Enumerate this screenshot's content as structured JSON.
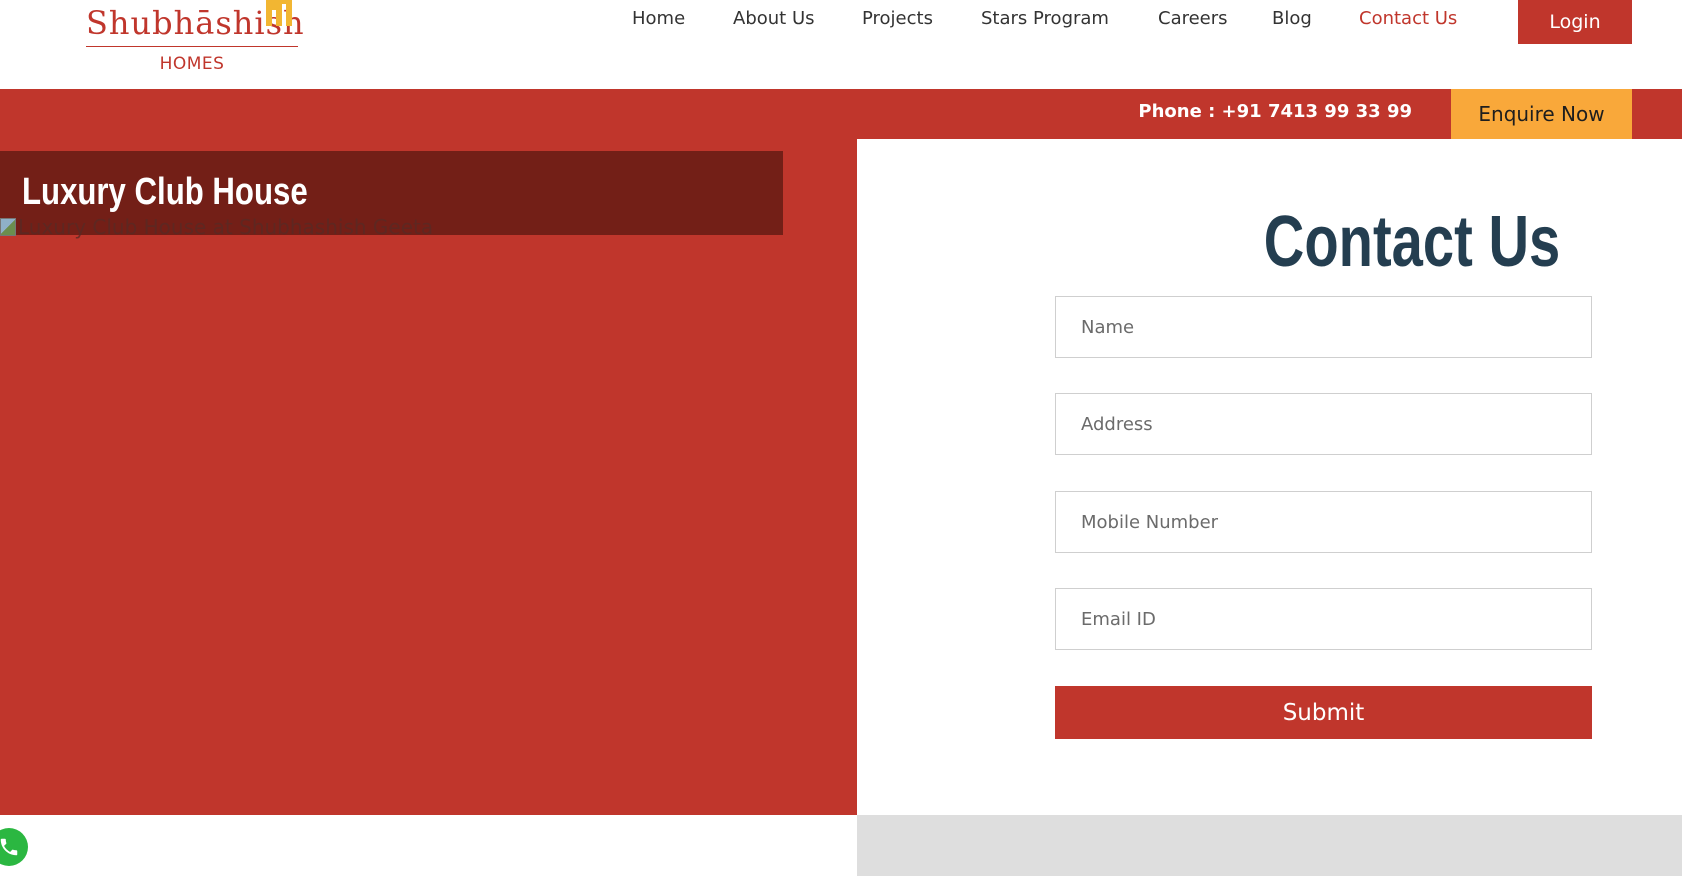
{
  "brand": {
    "name": "Shubhāshish",
    "subtitle": "HOMES",
    "logo_mark_icon": "building-crest-icon",
    "primary_color": "#c0362c",
    "accent_color": "#f9a83a",
    "mark_color": "#f2b632"
  },
  "nav": {
    "items": [
      {
        "label": "Home",
        "active": false
      },
      {
        "label": "About Us",
        "active": false
      },
      {
        "label": "Projects",
        "active": false
      },
      {
        "label": "Stars Program",
        "active": false
      },
      {
        "label": "Careers",
        "active": false
      },
      {
        "label": "Blog",
        "active": false
      },
      {
        "label": "Contact Us",
        "active": true
      }
    ],
    "login_label": "Login"
  },
  "topbar": {
    "phone_text": "Phone : +91 7413 99 33 99",
    "enquire_label": "Enquire Now"
  },
  "slide": {
    "title": "Luxury Club House",
    "image_alt": "Luxury Club House at Shubhashish Geeta"
  },
  "contact": {
    "title": "Contact Us",
    "fields": [
      {
        "placeholder": "Name",
        "value": ""
      },
      {
        "placeholder": "Address",
        "value": ""
      },
      {
        "placeholder": "Mobile Number",
        "value": ""
      },
      {
        "placeholder": "Email ID",
        "value": ""
      }
    ],
    "submit_label": "Submit"
  },
  "floating": {
    "whatsapp_icon": "whatsapp-icon",
    "whatsapp_color": "#2bb741"
  }
}
